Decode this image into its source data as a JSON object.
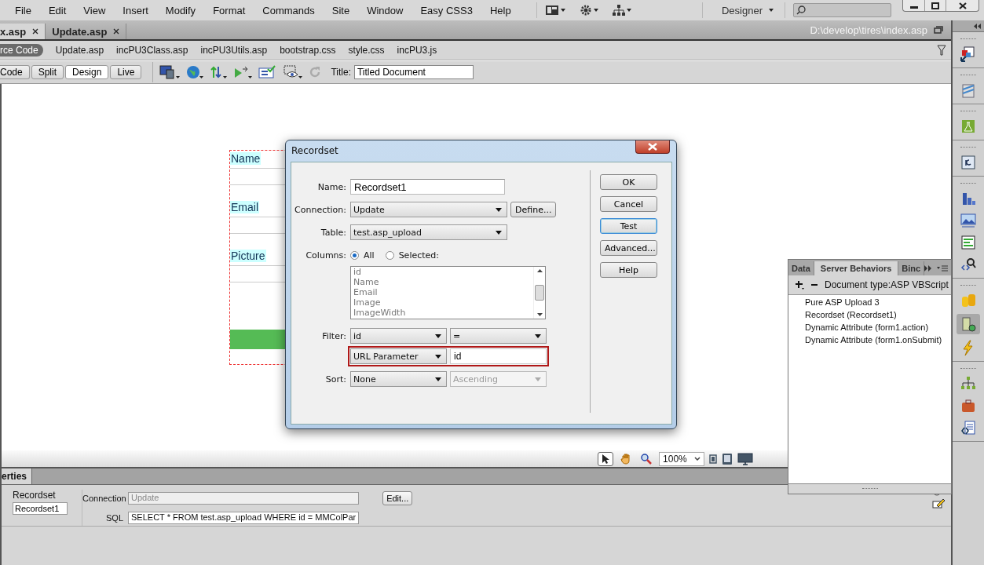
{
  "menu": [
    "File",
    "Edit",
    "View",
    "Insert",
    "Modify",
    "Format",
    "Commands",
    "Site",
    "Window",
    "Easy CSS3",
    "Help"
  ],
  "workspace": "Designer",
  "doc_tabs": [
    {
      "label": "x.asp",
      "selected": true
    },
    {
      "label": "Update.asp",
      "selected": false
    }
  ],
  "doc_path": "D:\\develop\\tires\\index.asp",
  "related_files": [
    {
      "label": "rce Code",
      "selected": true
    },
    {
      "label": "Update.asp",
      "selected": false
    },
    {
      "label": "incPU3Class.asp",
      "selected": false
    },
    {
      "label": "incPU3Utils.asp",
      "selected": false
    },
    {
      "label": "bootstrap.css",
      "selected": false
    },
    {
      "label": "style.css",
      "selected": false
    },
    {
      "label": "incPU3.js",
      "selected": false
    }
  ],
  "view_buttons": [
    {
      "label": "Code",
      "selected": false
    },
    {
      "label": "Split",
      "selected": false
    },
    {
      "label": "Design",
      "selected": true
    },
    {
      "label": "Live",
      "selected": false
    }
  ],
  "title_field": {
    "label": "Title:",
    "value": "Titled Document"
  },
  "design_form": {
    "labels": [
      "Name",
      "Email",
      "Picture"
    ]
  },
  "status_bar": {
    "tools": [
      {
        "kind": "pointer",
        "selected": true
      },
      {
        "kind": "hand",
        "selected": false
      },
      {
        "kind": "zoom",
        "selected": false
      }
    ],
    "zoom": "100%"
  },
  "properties": {
    "tab": "erties",
    "recordset_label": "Recordset",
    "recordset_value": "Recordset1",
    "connection_label": "Connection",
    "connection_value": "Update",
    "sql_label": "SQL",
    "sql_value": "SELECT * FROM test.asp_upload WHERE id = MMColPar",
    "edit_button": "Edit..."
  },
  "dialog": {
    "title": "Recordset",
    "name": {
      "label": "Name:",
      "value": "Recordset1"
    },
    "connection": {
      "label": "Connection:",
      "value": "Update",
      "button": "Define..."
    },
    "table": {
      "label": "Table:",
      "value": "test.asp_upload"
    },
    "columns": {
      "label": "Columns:",
      "options": [
        {
          "label": "All",
          "selected": true
        },
        {
          "label": "Selected:",
          "selected": false
        }
      ],
      "items": [
        "id",
        "Name",
        "Email",
        "Image",
        "ImageWidth"
      ]
    },
    "filter": {
      "label": "Filter:",
      "column": "id",
      "operator": "=",
      "source": "URL Parameter",
      "value": "id"
    },
    "sort": {
      "label": "Sort:",
      "column": "None",
      "order": "Ascending",
      "order_disabled": true
    },
    "buttons": [
      {
        "label": "OK",
        "focused": false
      },
      {
        "label": "Cancel",
        "focused": false
      },
      {
        "label": "Test",
        "focused": true
      },
      {
        "label": "Advanced...",
        "focused": false
      },
      {
        "label": "Help",
        "focused": false
      }
    ]
  },
  "server_panel": {
    "tabs": [
      {
        "label": "Data",
        "selected": false
      },
      {
        "label": "Server Behaviors",
        "selected": true
      },
      {
        "label": "Binc",
        "selected": false
      }
    ],
    "document_type": "Document type:ASP VBScript",
    "items": [
      "Pure ASP Upload 3",
      "Recordset (Recordset1)",
      "Dynamic Attribute (form1.action)",
      "Dynamic Attribute (form1.onSubmit)"
    ]
  }
}
